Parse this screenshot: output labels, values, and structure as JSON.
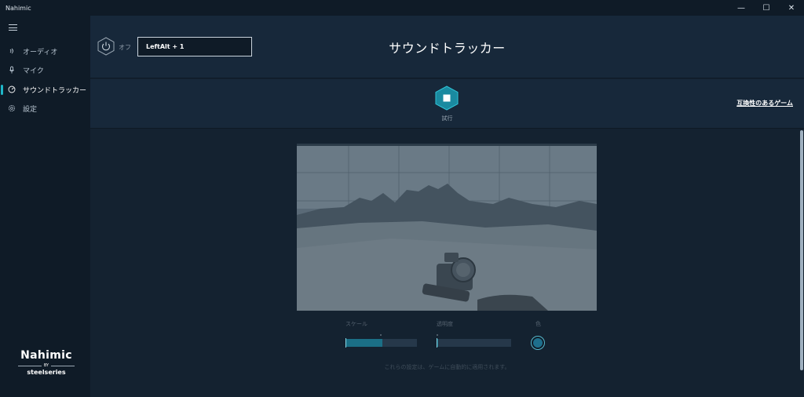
{
  "window": {
    "title": "Nahimic",
    "minimize": "—",
    "maximize": "☐",
    "close": "✕"
  },
  "sidebar": {
    "items": [
      {
        "label": "オーディオ",
        "icon": "speaker-icon"
      },
      {
        "label": "マイク",
        "icon": "microphone-icon"
      },
      {
        "label": "サウンドトラッカー",
        "icon": "tracker-icon"
      },
      {
        "label": "設定",
        "icon": "gear-icon"
      }
    ],
    "brand": {
      "name": "Nahimic",
      "by": "BY",
      "maker": "steelseries"
    }
  },
  "header": {
    "power_label": "オフ",
    "hotkey": "LeftAlt + 1",
    "title": "サウンドトラッカー"
  },
  "test": {
    "label": "試行",
    "compat_link": "互換性のあるゲーム"
  },
  "controls": {
    "scale_label": "スケール",
    "opacity_label": "透明度",
    "color_label": "色",
    "scale_value": 0.52,
    "opacity_value": 0.02,
    "accent_color": "#1e6f8c",
    "footnote": "これらの設定は、ゲームに自動的に適用されます。"
  },
  "colors": {
    "accent": "#1fb6c8",
    "background": "#142230",
    "sidebar": "#0f1b27"
  }
}
